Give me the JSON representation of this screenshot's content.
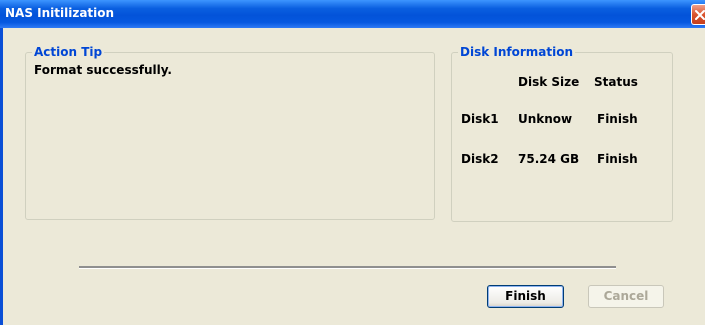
{
  "window": {
    "title": "NAS Initilization",
    "close_icon": "close-x"
  },
  "action_tip": {
    "legend": "Action Tip",
    "message": "Format successfully."
  },
  "disk_info": {
    "legend": "Disk Information",
    "headers": [
      "Disk Size",
      "Status"
    ],
    "disks": [
      {
        "name": "Disk1",
        "size": "Unknow",
        "status": "Finish"
      },
      {
        "name": "Disk2",
        "size": "75.24 GB",
        "status": "Finish"
      }
    ]
  },
  "buttons": {
    "finish": "Finish",
    "cancel": "Cancel",
    "cancel_enabled": false
  },
  "colors": {
    "titlebar": "#0353d9",
    "legend_text": "#0046d5",
    "window_bg": "#ece9d8"
  }
}
